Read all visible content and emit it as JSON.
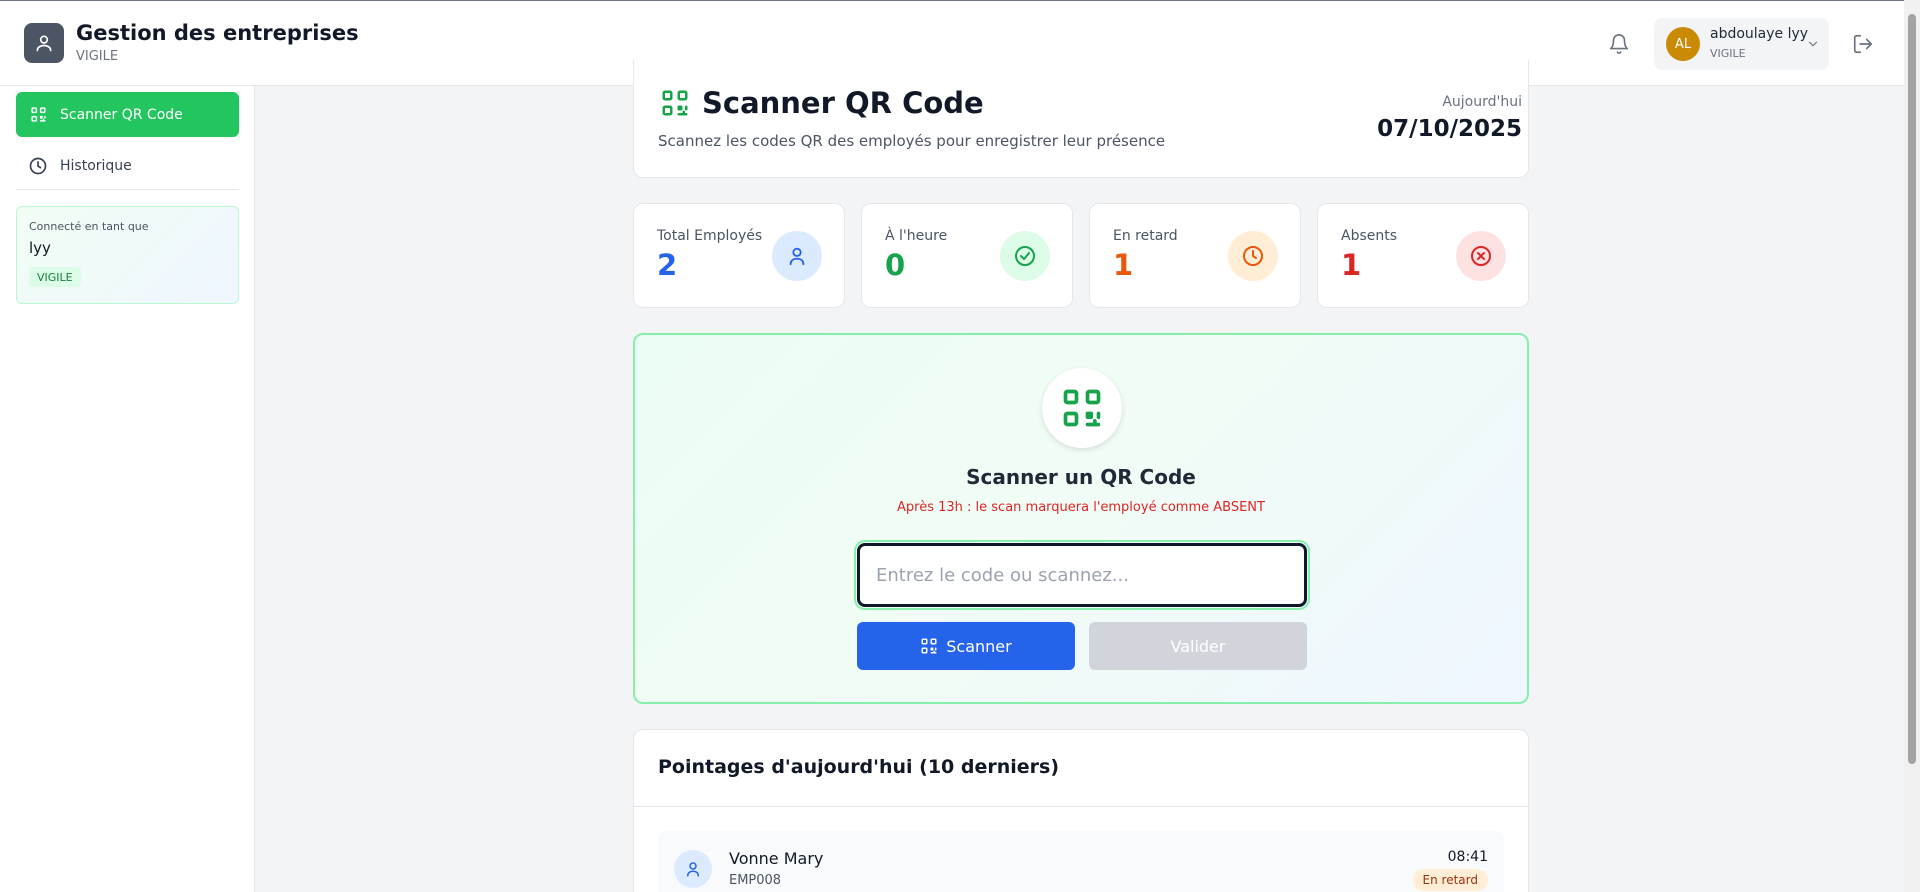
{
  "header": {
    "app_title": "Gestion des entreprises",
    "app_subtitle": "VIGILE",
    "user": {
      "initials": "AL",
      "name": "abdoulaye lyy",
      "role": "VIGILE"
    }
  },
  "sidebar": {
    "items": [
      {
        "label": "Scanner QR Code",
        "icon": "qr-code-icon",
        "active": true
      },
      {
        "label": "Historique",
        "icon": "clock-icon",
        "active": false
      }
    ],
    "connected": {
      "label": "Connecté en tant que",
      "name": "lyy",
      "role": "VIGILE"
    }
  },
  "page": {
    "title": "Scanner QR Code",
    "subtitle": "Scannez les codes QR des employés pour enregistrer leur présence",
    "today_label": "Aujourd'hui",
    "today_date": "07/10/2025"
  },
  "stats": [
    {
      "label": "Total Employés",
      "value": "2",
      "color": "#2563eb",
      "icon": "user-icon"
    },
    {
      "label": "À l'heure",
      "value": "0",
      "color": "#16a34a",
      "icon": "check-circle-icon"
    },
    {
      "label": "En retard",
      "value": "1",
      "color": "#ea580c",
      "icon": "clock-icon"
    },
    {
      "label": "Absents",
      "value": "1",
      "color": "#dc2626",
      "icon": "x-circle-icon"
    }
  ],
  "scanner": {
    "title": "Scanner un QR Code",
    "warning": "Après 13h : le scan marquera l'employé comme ABSENT",
    "input_placeholder": "Entrez le code ou scannez...",
    "input_value": "",
    "scan_label": "Scanner",
    "validate_label": "Valider"
  },
  "pointages": {
    "title": "Pointages d'aujourd'hui (10 derniers)",
    "rows": [
      {
        "name": "Vonne Mary",
        "code": "EMP008",
        "time": "08:41",
        "status": "En retard"
      }
    ]
  },
  "colors": {
    "accent_green": "#22c55e",
    "primary_blue": "#2563eb",
    "late_orange": "#ea580c",
    "absent_red": "#dc2626"
  }
}
